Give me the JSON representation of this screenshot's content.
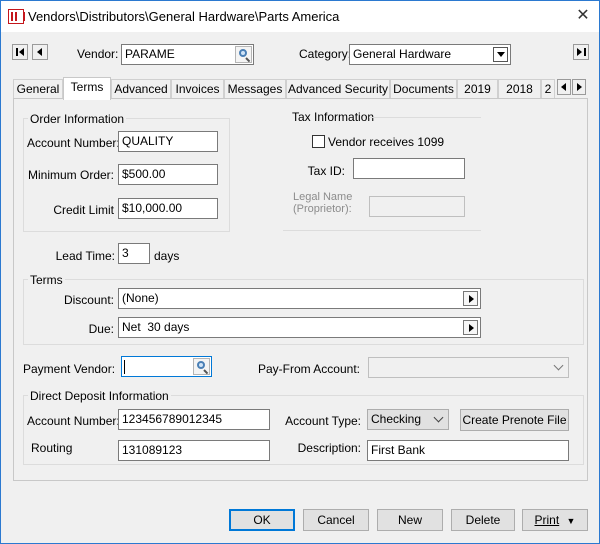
{
  "window": {
    "title": "Vendors\\Distributors\\General Hardware\\Parts America",
    "close_glyph": "✕"
  },
  "header": {
    "vendor_label": "Vendor:",
    "vendor_value": "PARAME",
    "category_label": "Category:",
    "category_value": "General Hardware"
  },
  "tabs": [
    {
      "label": "General"
    },
    {
      "label": "Terms"
    },
    {
      "label": "Advanced"
    },
    {
      "label": "Invoices"
    },
    {
      "label": "Messages"
    },
    {
      "label": "Advanced Security"
    },
    {
      "label": "Documents"
    },
    {
      "label": "2019"
    },
    {
      "label": "2018"
    },
    {
      "label": "2"
    }
  ],
  "active_tab": "Terms",
  "order_info": {
    "title": "Order Information",
    "account_number_label": "Account Number:",
    "account_number": "QUALITY",
    "minimum_order_label": "Minimum Order:",
    "minimum_order": "$500.00",
    "credit_limit_label": "Credit Limit",
    "credit_limit": "$10,000.00"
  },
  "tax_info": {
    "title": "Tax Information",
    "vendor_1099_label": "Vendor receives 1099",
    "vendor_1099_checked": false,
    "tax_id_label": "Tax ID:",
    "tax_id": "",
    "legal_name_label_1": "Legal Name",
    "legal_name_label_2": "(Proprietor):",
    "legal_name": ""
  },
  "lead_time": {
    "label": "Lead Time:",
    "value": "3",
    "unit": "days"
  },
  "terms": {
    "title": "Terms",
    "discount_label": "Discount:",
    "discount_value": "(None)",
    "due_label": "Due:",
    "due_value": "Net  30 days"
  },
  "payment": {
    "payment_vendor_label": "Payment Vendor:",
    "payment_vendor_value": "",
    "pay_from_label": "Pay-From Account:",
    "pay_from_value": ""
  },
  "direct_deposit": {
    "title": "Direct Deposit Information",
    "account_number_label": "Account Number:",
    "account_number": "123456789012345",
    "routing_label": "Routing",
    "routing": "131089123",
    "account_type_label": "Account Type:",
    "account_type": "Checking",
    "create_prenote_label": "Create Prenote File",
    "description_label": "Description:",
    "description": "First Bank"
  },
  "footer": {
    "ok": "OK",
    "cancel": "Cancel",
    "new": "New",
    "delete": "Delete",
    "print": "Print",
    "print_arrow": "▼"
  }
}
